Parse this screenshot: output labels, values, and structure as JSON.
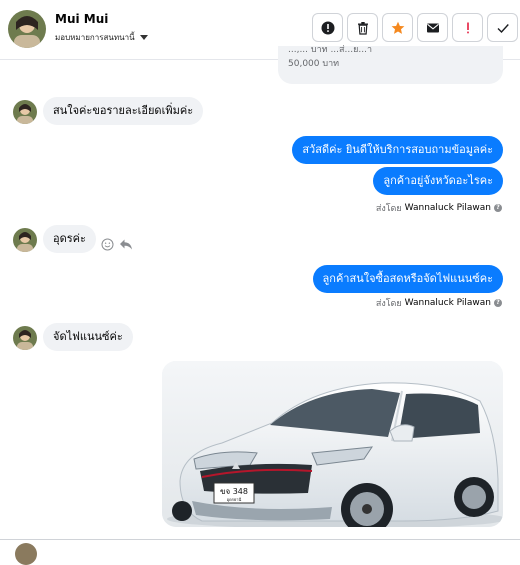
{
  "header": {
    "name": "Mui Mui",
    "assign_label": "มอบหมายการสนทนานี้"
  },
  "messages": {
    "top_partial_line1": "...,... บาท ...ส่...ย...า",
    "top_partial_line2": "50,000 บาท",
    "in1": "สนใจค่ะขอรายละเอียดเพิ่มค่ะ",
    "out1": "สวัสดีค่ะ  ยินดีให้บริการสอบถามข้อมูลค่ะ",
    "out2": "ลูกค้าอยู่จังหวัดอะไรคะ",
    "sent_by_prefix": "ส่งโดย",
    "sent_by_name": "Wannaluck Pilawan",
    "in2": "อุดรค่ะ",
    "out3": "ลูกค้าสนใจซื้อสดหรือจัดไฟแนนซ์คะ",
    "in3": "จัดไฟแนนซ์ค่ะ",
    "plate_line1": "ขจ 348",
    "plate_line2": "อุดรธานี"
  },
  "colors": {
    "accent_blue": "#0a7cff",
    "incoming_bg": "#f0f2f5",
    "star": "#f5891f",
    "alert_red": "#e41e3f"
  }
}
